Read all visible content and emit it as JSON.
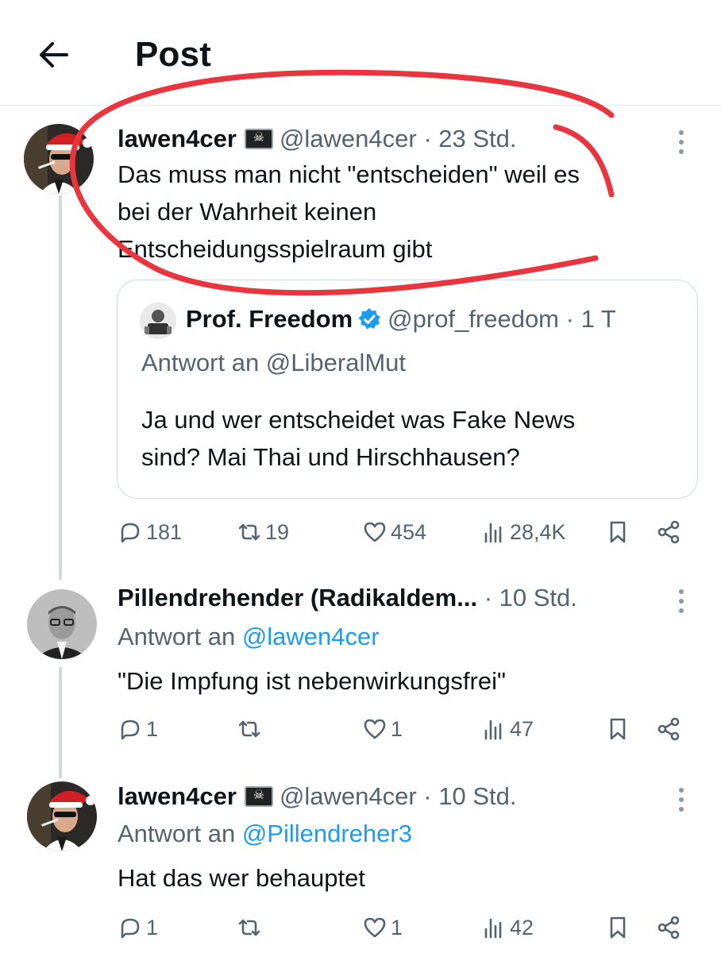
{
  "header": {
    "title": "Post"
  },
  "main_tweet": {
    "name": "lawen4cer",
    "flag_glyph": "☠",
    "handle": "@lawen4cer",
    "time": "· 23 Std.",
    "text_lines": [
      "Das muss man nicht \"entscheiden\" weil es",
      "bei der Wahrheit keinen",
      "Entscheidungsspielraum gibt"
    ],
    "quote": {
      "name": "Prof. Freedom",
      "handle": "@prof_freedom",
      "time": "· 1 T",
      "reply_to": "Antwort an @LiberalMut",
      "text_lines": [
        "Ja und wer entscheidet was Fake News",
        "sind? Mai Thai und Hirschhausen?"
      ]
    },
    "actions": {
      "replies": "181",
      "reposts": "19",
      "likes": "454",
      "views": "28,4K"
    }
  },
  "replies": [
    {
      "name": "Pillendrehender (Radikaldem...",
      "time": "· 10 Std.",
      "reply_prefix": "Antwort an ",
      "reply_mention": "@lawen4cer",
      "text": "\"Die Impfung ist nebenwirkungsfrei\"",
      "actions": {
        "replies": "1",
        "reposts": "",
        "likes": "1",
        "views": "47"
      }
    },
    {
      "name": "lawen4cer",
      "flag_glyph": "☠",
      "handle": "@lawen4cer",
      "time": "· 10 Std.",
      "reply_prefix": "Antwort an ",
      "reply_mention": "@Pillendreher3",
      "text": "Hat das wer behauptet",
      "actions": {
        "replies": "1",
        "reposts": "",
        "likes": "1",
        "views": "42"
      }
    }
  ],
  "icons": {
    "back": "arrow-left-icon",
    "more": "more-vertical-icon",
    "reply": "speech-bubble-icon",
    "repost": "repost-icon",
    "like": "heart-icon",
    "views": "bar-chart-icon",
    "bookmark": "bookmark-icon",
    "share": "share-icon",
    "verified": "verified-badge-icon"
  },
  "colors": {
    "text": "#0f1419",
    "secondary": "#536471",
    "link": "#1d9bf0",
    "border": "#cfd9de",
    "annotation": "#e8353e"
  }
}
